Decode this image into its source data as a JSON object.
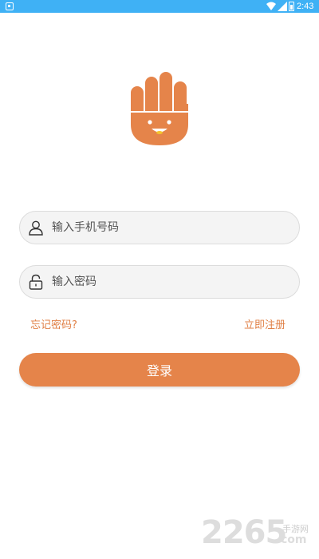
{
  "status_bar": {
    "time": "2:43",
    "icons": [
      "notification-icon",
      "wifi-icon",
      "signal-icon",
      "battery-icon"
    ]
  },
  "logo": {
    "icon": "hand-mascot-icon"
  },
  "login_form": {
    "phone": {
      "placeholder": "输入手机号码",
      "value": "",
      "icon": "user-icon"
    },
    "password": {
      "placeholder": "输入密码",
      "value": "",
      "icon": "lock-icon"
    },
    "forgot_password": "忘记密码?",
    "register": "立即注册",
    "submit": "登录"
  },
  "watermark": {
    "digits": "2265",
    "site": "手游网",
    "domain": "com"
  },
  "colors": {
    "status_bar": "#3fb1f5",
    "accent": "#e5844a",
    "link": "#e07f45",
    "field_bg": "#f4f4f4"
  }
}
